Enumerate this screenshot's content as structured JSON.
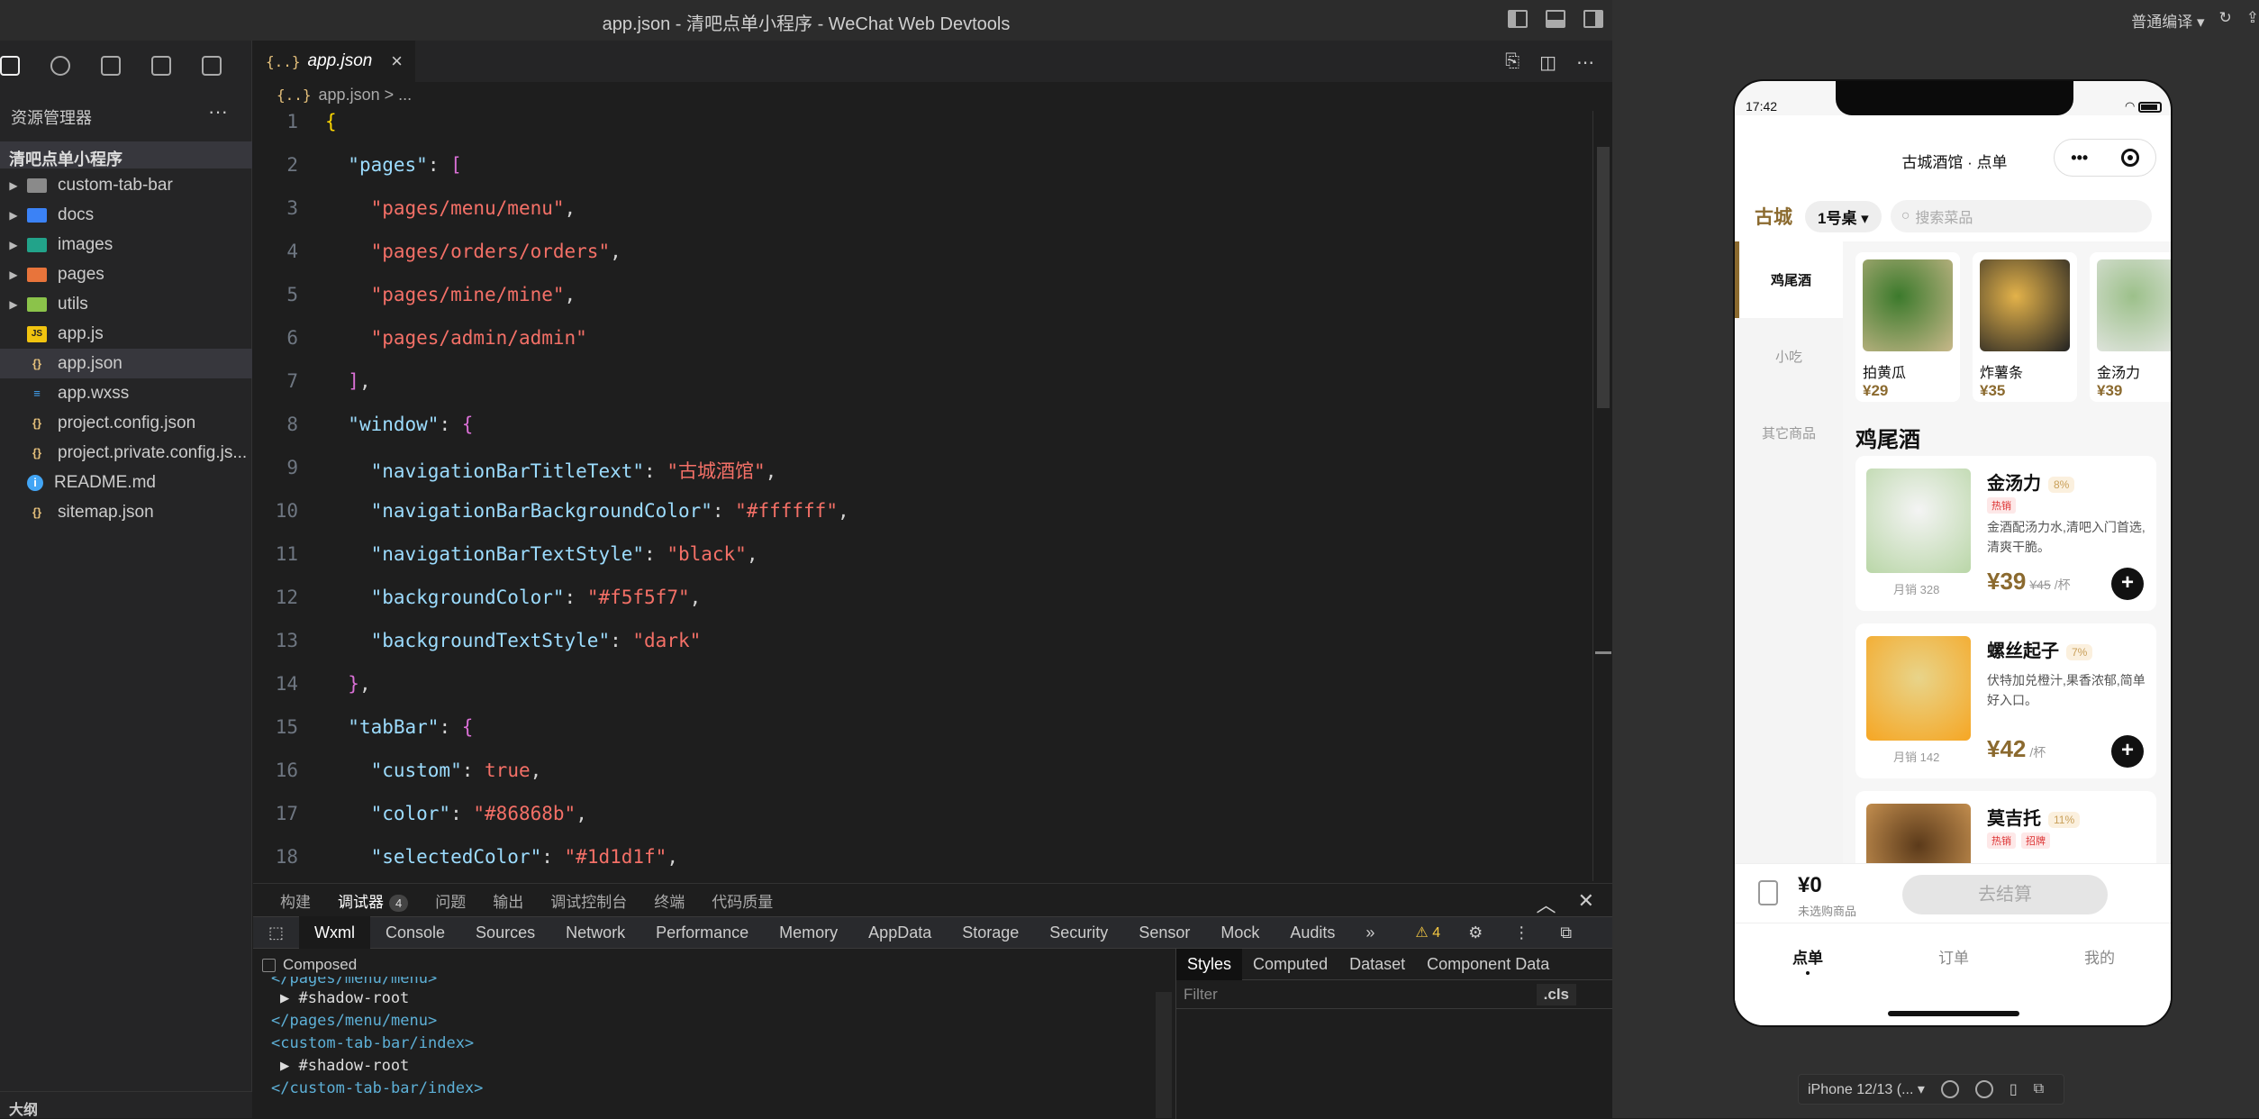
{
  "window": {
    "title": "app.json - 清吧点单小程序 - WeChat Web Devtools"
  },
  "activity": [
    "explorer-icon",
    "search-icon",
    "source-control-icon",
    "extensions-icon",
    "more-icon"
  ],
  "explorer": {
    "title": "资源管理器",
    "more": "···",
    "project": "清吧点单小程序",
    "items": [
      {
        "name": "custom-tab-bar",
        "type": "folder",
        "icon": "folder-icon",
        "color": "#8a8a8a"
      },
      {
        "name": "docs",
        "type": "folder",
        "icon": "docs-folder-icon",
        "color": "#3b82f6"
      },
      {
        "name": "images",
        "type": "folder",
        "icon": "images-folder-icon",
        "color": "#22a38a"
      },
      {
        "name": "pages",
        "type": "folder",
        "icon": "pages-folder-icon",
        "color": "#e8743b"
      },
      {
        "name": "utils",
        "type": "folder",
        "icon": "utils-folder-icon",
        "color": "#8bc34a"
      },
      {
        "name": "app.js",
        "type": "file",
        "icon": "js-file-icon",
        "color": "#f1c40f"
      },
      {
        "name": "app.json",
        "type": "file",
        "icon": "json-file-icon",
        "color": "#e5c07b",
        "selected": true
      },
      {
        "name": "app.wxss",
        "type": "file",
        "icon": "css-file-icon",
        "color": "#42a5f5"
      },
      {
        "name": "project.config.json",
        "type": "file",
        "icon": "json-file-icon",
        "color": "#e5c07b"
      },
      {
        "name": "project.private.config.js...",
        "type": "file",
        "icon": "json-file-icon",
        "color": "#e5c07b"
      },
      {
        "name": "README.md",
        "type": "file",
        "icon": "info-file-icon",
        "color": "#42a5f5"
      },
      {
        "name": "sitemap.json",
        "type": "file",
        "icon": "json-file-icon",
        "color": "#e5c07b"
      }
    ],
    "outline": "大纲"
  },
  "editor": {
    "tab": "app.json",
    "tab_icon": "{..}",
    "breadcrumb": "app.json > ...",
    "lines": [
      {
        "n": "1",
        "t": [
          [
            "b1",
            "{"
          ]
        ]
      },
      {
        "n": "2",
        "t": [
          [
            "p",
            "  "
          ],
          [
            "k",
            "\"pages\""
          ],
          [
            "p",
            ": "
          ],
          [
            "b2",
            "["
          ]
        ]
      },
      {
        "n": "3",
        "t": [
          [
            "p",
            "    "
          ],
          [
            "s",
            "\"pages/menu/menu\""
          ],
          [
            "p",
            ","
          ]
        ]
      },
      {
        "n": "4",
        "t": [
          [
            "p",
            "    "
          ],
          [
            "s",
            "\"pages/orders/orders\""
          ],
          [
            "p",
            ","
          ]
        ]
      },
      {
        "n": "5",
        "t": [
          [
            "p",
            "    "
          ],
          [
            "s",
            "\"pages/mine/mine\""
          ],
          [
            "p",
            ","
          ]
        ]
      },
      {
        "n": "6",
        "t": [
          [
            "p",
            "    "
          ],
          [
            "s",
            "\"pages/admin/admin\""
          ]
        ]
      },
      {
        "n": "7",
        "t": [
          [
            "p",
            "  "
          ],
          [
            "b2",
            "]"
          ],
          [
            "p",
            ","
          ]
        ]
      },
      {
        "n": "8",
        "t": [
          [
            "p",
            "  "
          ],
          [
            "k",
            "\"window\""
          ],
          [
            "p",
            ": "
          ],
          [
            "b2",
            "{"
          ]
        ]
      },
      {
        "n": "9",
        "t": [
          [
            "p",
            "    "
          ],
          [
            "k",
            "\"navigationBarTitleText\""
          ],
          [
            "p",
            ": "
          ],
          [
            "s",
            "\"古城酒馆\""
          ],
          [
            "p",
            ","
          ]
        ]
      },
      {
        "n": "10",
        "t": [
          [
            "p",
            "    "
          ],
          [
            "k",
            "\"navigationBarBackgroundColor\""
          ],
          [
            "p",
            ": "
          ],
          [
            "s",
            "\"#ffffff\""
          ],
          [
            "p",
            ","
          ]
        ]
      },
      {
        "n": "11",
        "t": [
          [
            "p",
            "    "
          ],
          [
            "k",
            "\"navigationBarTextStyle\""
          ],
          [
            "p",
            ": "
          ],
          [
            "s",
            "\"black\""
          ],
          [
            "p",
            ","
          ]
        ]
      },
      {
        "n": "12",
        "t": [
          [
            "p",
            "    "
          ],
          [
            "k",
            "\"backgroundColor\""
          ],
          [
            "p",
            ": "
          ],
          [
            "s",
            "\"#f5f5f7\""
          ],
          [
            "p",
            ","
          ]
        ]
      },
      {
        "n": "13",
        "t": [
          [
            "p",
            "    "
          ],
          [
            "k",
            "\"backgroundTextStyle\""
          ],
          [
            "p",
            ": "
          ],
          [
            "s",
            "\"dark\""
          ]
        ]
      },
      {
        "n": "14",
        "t": [
          [
            "p",
            "  "
          ],
          [
            "b2",
            "}"
          ],
          [
            "p",
            ","
          ]
        ]
      },
      {
        "n": "15",
        "t": [
          [
            "p",
            "  "
          ],
          [
            "k",
            "\"tabBar\""
          ],
          [
            "p",
            ": "
          ],
          [
            "b2",
            "{"
          ]
        ]
      },
      {
        "n": "16",
        "t": [
          [
            "p",
            "    "
          ],
          [
            "k",
            "\"custom\""
          ],
          [
            "p",
            ": "
          ],
          [
            "kw",
            "true"
          ],
          [
            "p",
            ","
          ]
        ]
      },
      {
        "n": "17",
        "t": [
          [
            "p",
            "    "
          ],
          [
            "k",
            "\"color\""
          ],
          [
            "p",
            ": "
          ],
          [
            "s",
            "\"#86868b\""
          ],
          [
            "p",
            ","
          ]
        ]
      },
      {
        "n": "18",
        "t": [
          [
            "p",
            "    "
          ],
          [
            "k",
            "\"selectedColor\""
          ],
          [
            "p",
            ": "
          ],
          [
            "s",
            "\"#1d1d1f\""
          ],
          [
            "p",
            ","
          ]
        ]
      }
    ]
  },
  "panel": {
    "tabs": [
      "构建",
      "调试器",
      "问题",
      "输出",
      "调试控制台",
      "终端",
      "代码质量"
    ],
    "active": "调试器",
    "badge": "4",
    "devtools": [
      "Wxml",
      "Console",
      "Sources",
      "Network",
      "Performance",
      "Memory",
      "AppData",
      "Storage",
      "Security",
      "Sensor",
      "Mock",
      "Audits",
      "»"
    ],
    "warnings": "⚠ 4",
    "composed": "Composed",
    "wxml": [
      {
        "cls": "tag",
        "text": "</pages/menu/menu>",
        "indent": 0,
        "clip": true
      },
      {
        "cls": "sr",
        "text": "▶ #shadow-root",
        "indent": 1
      },
      {
        "cls": "tag",
        "text": "</pages/menu/menu>",
        "indent": 0
      },
      {
        "cls": "tag",
        "text": "<custom-tab-bar/index>",
        "indent": 0
      },
      {
        "cls": "sr",
        "text": "▶ #shadow-root",
        "indent": 1
      },
      {
        "cls": "tag",
        "text": "</custom-tab-bar/index>",
        "indent": 0
      }
    ],
    "styles_tabs": [
      "Styles",
      "Computed",
      "Dataset",
      "Component Data"
    ],
    "filter": "Filter",
    "cls": ".cls",
    "plus": "+"
  },
  "sim": {
    "compile_mode": "普通编译 ▾",
    "time": "17:42",
    "nav_title": "古城酒馆 · 点单",
    "capsule_dots": "•••",
    "city": "古城",
    "table": "1号桌 ▾",
    "search": "搜索菜品",
    "categories": [
      "鸡尾酒",
      "小吃",
      "其它商品"
    ],
    "hot": [
      {
        "name": "拍黄瓜",
        "price": "¥29",
        "c1": "#3c7a2c",
        "c2": "#c8b88a"
      },
      {
        "name": "炸薯条",
        "price": "¥35",
        "c1": "#e3b24a",
        "c2": "#222"
      },
      {
        "name": "金汤力",
        "price": "¥39",
        "c1": "#9cc08a",
        "c2": "#e9e9e9"
      }
    ],
    "section": "鸡尾酒",
    "items": [
      {
        "name": "金汤力",
        "pct": "8%",
        "tags": [
          "热销"
        ],
        "desc": "金酒配汤力水,清吧入门首选,清爽干脆。",
        "price": "¥39",
        "old": "¥45",
        "unit": "/杯",
        "sold": "月销 328",
        "c1": "#b9d6a7",
        "c2": "#f4f4f4"
      },
      {
        "name": "螺丝起子",
        "pct": "7%",
        "tags": [],
        "desc": "伏特加兑橙汁,果香浓郁,简单好入口。",
        "price": "¥42",
        "old": "",
        "unit": "/杯",
        "sold": "月销 142",
        "c1": "#f6a623",
        "c2": "#e8d48a"
      },
      {
        "name": "莫吉托",
        "pct": "11%",
        "tags": [
          "热销",
          "招牌"
        ],
        "desc": "",
        "price": "",
        "old": "",
        "unit": "",
        "sold": "",
        "c1": "#d9a05a",
        "c2": "#5b3a1a"
      }
    ],
    "cart_total": "¥0",
    "cart_sub": "未选购商品",
    "checkout": "去结算",
    "tabbar": [
      "点单",
      "订单",
      "我的"
    ],
    "device": "iPhone 12/13 (... ▾"
  }
}
